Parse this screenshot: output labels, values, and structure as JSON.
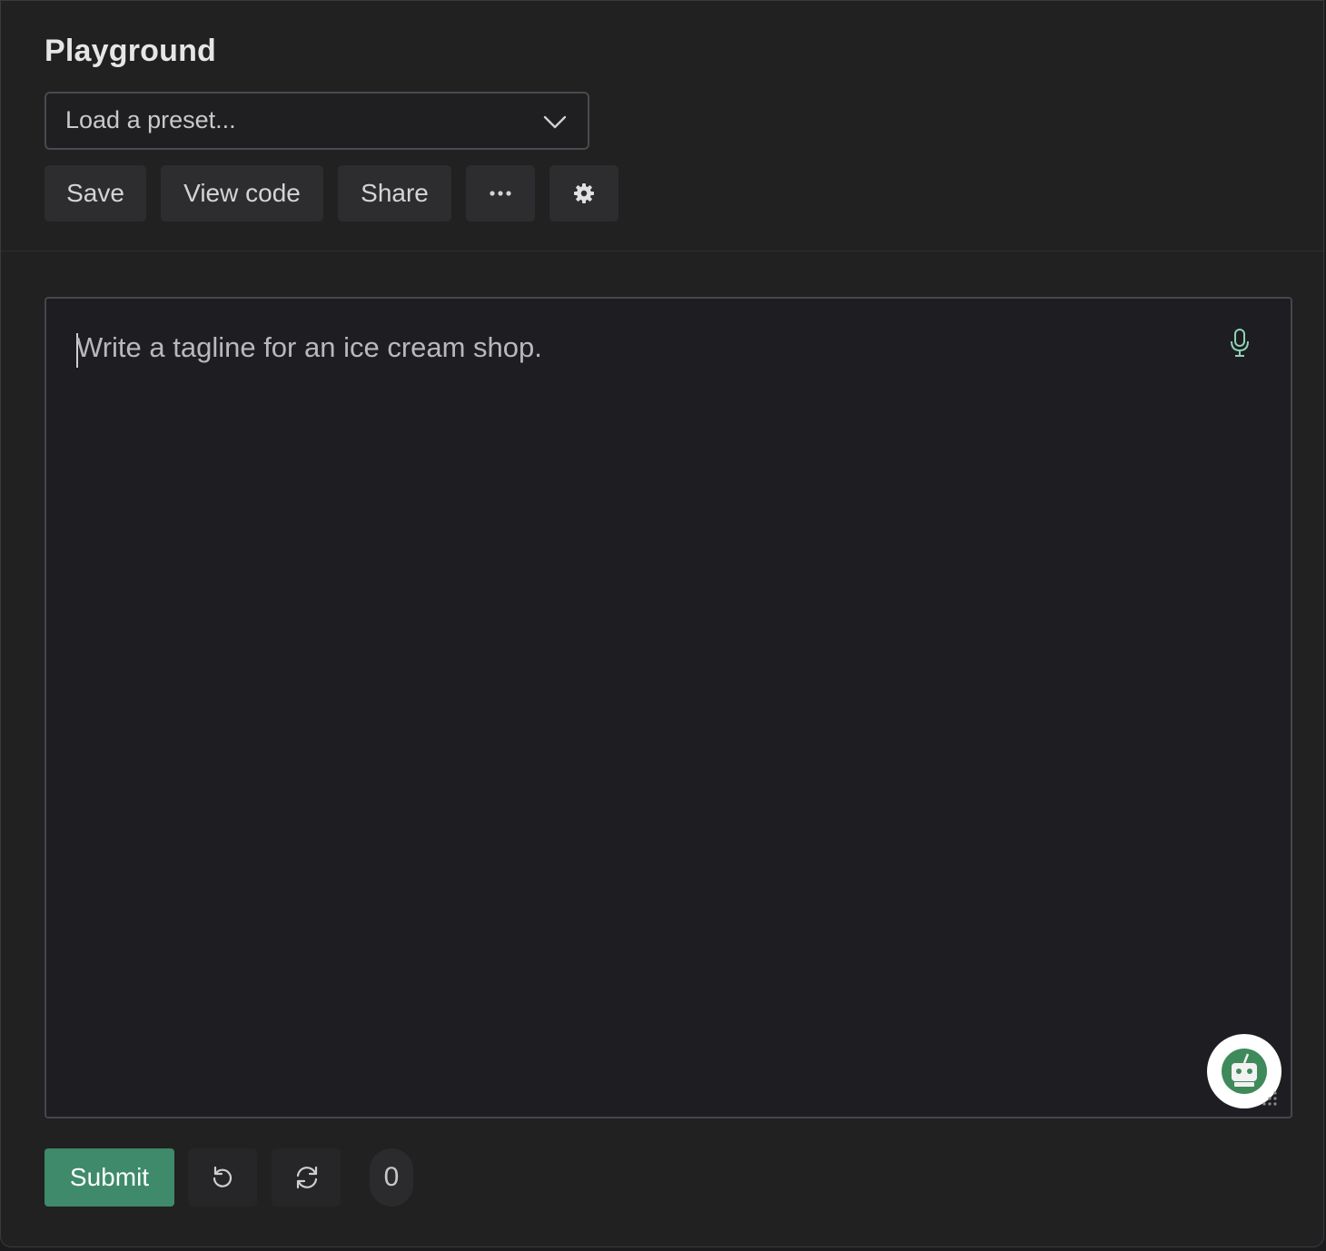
{
  "header": {
    "title": "Playground",
    "preset": {
      "placeholder": "Load a preset..."
    },
    "toolbar": {
      "save_label": "Save",
      "view_code_label": "View code",
      "share_label": "Share",
      "more_icon": "ellipsis-icon",
      "settings_icon": "gear-icon"
    }
  },
  "editor": {
    "placeholder": "Write a tagline for an ice cream shop.",
    "mic_icon": "microphone-icon",
    "assistant_icon": "robot-assistant-icon"
  },
  "footer": {
    "submit_label": "Submit",
    "undo_icon": "undo-icon",
    "regenerate_icon": "regenerate-icon",
    "token_count": "0"
  },
  "colors": {
    "background": "#212121",
    "accent": "#3e8a6b",
    "mic": "#8fd1b6"
  }
}
